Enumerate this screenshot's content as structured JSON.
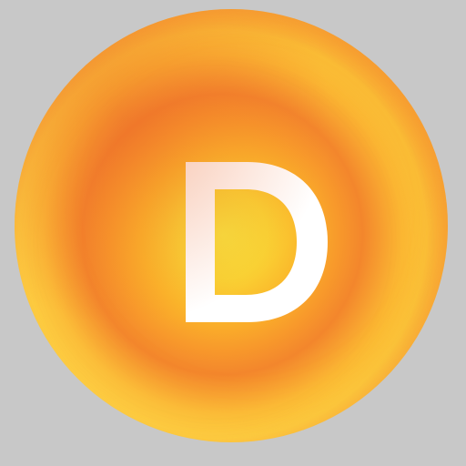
{
  "icon": {
    "name": "D logo",
    "letter": "D",
    "colors": {
      "background": "#c8c8c8",
      "circle_outer": "#f08a35",
      "circle_mid": "#fbb733",
      "circle_inner": "#f7e23e",
      "letter": "#ffffff"
    }
  }
}
